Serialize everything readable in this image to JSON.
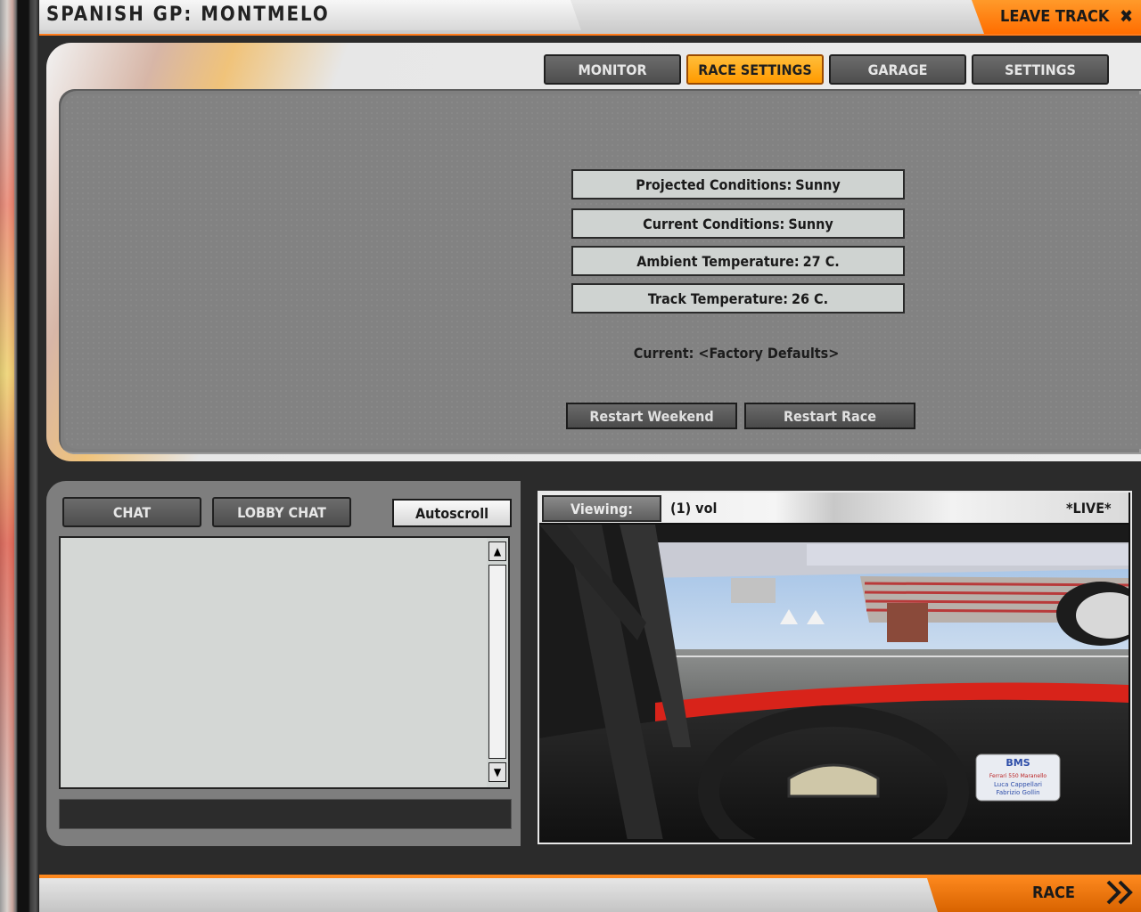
{
  "header": {
    "track_title": "SPANISH GP: MONTMELO",
    "leave_track_label": "LEAVE TRACK",
    "close_icon": "✖"
  },
  "tabs": [
    {
      "label": "MONITOR",
      "active": false
    },
    {
      "label": "RACE SETTINGS",
      "active": true
    },
    {
      "label": "GARAGE",
      "active": false
    },
    {
      "label": "SETTINGS",
      "active": false
    }
  ],
  "conditions": {
    "projected_label": "Projected Conditions:",
    "projected_value": "Sunny",
    "current_label": "Current Conditions:",
    "current_value": "Sunny",
    "ambient_label": "Ambient Temperature:",
    "ambient_value": "27 C.",
    "track_label": "Track Temperature:",
    "track_value": "26 C."
  },
  "setup": {
    "current_label": "Current:",
    "current_value": "<Factory Defaults>"
  },
  "actions": {
    "restart_weekend": "Restart Weekend",
    "restart_race": "Restart Race"
  },
  "chat": {
    "chat_tab": "CHAT",
    "lobby_chat_tab": "LOBBY CHAT",
    "autoscroll_label": "Autoscroll",
    "scroll_up_icon": "▲",
    "scroll_down_icon": "▼",
    "input_value": ""
  },
  "viewer": {
    "viewing_label": "Viewing:",
    "driver": "(1) vol",
    "live_label": "*LIVE*",
    "sticker_brand": "BMS",
    "sticker_line1": "Ferrari 550 Maranello",
    "sticker_line2": "Luca Cappellari",
    "sticker_line3": "Fabrizio Gollin"
  },
  "footer": {
    "race_label": "RACE"
  },
  "colors": {
    "accent_orange": "#ff8a1f",
    "active_tab": "#ffae1a",
    "panel_gray": "#828282",
    "field_bg": "#cfd3d1"
  }
}
